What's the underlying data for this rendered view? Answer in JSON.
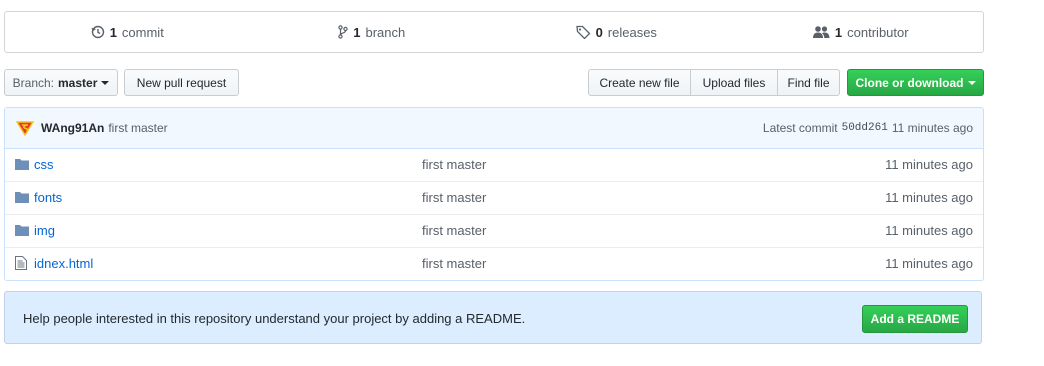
{
  "stats": {
    "commits": {
      "count": "1",
      "label": "commit",
      "icon": "history-icon"
    },
    "branches": {
      "count": "1",
      "label": "branch",
      "icon": "git-branch-icon"
    },
    "releases": {
      "count": "0",
      "label": "releases",
      "icon": "tag-icon"
    },
    "contributors": {
      "count": "1",
      "label": "contributor",
      "icon": "people-icon"
    }
  },
  "toolbar": {
    "branch_prefix": "Branch:",
    "branch_name": "master",
    "new_pull_request": "New pull request",
    "create_new_file": "Create new file",
    "upload_files": "Upload files",
    "find_file": "Find file",
    "clone_or_download": "Clone or download"
  },
  "latest_commit": {
    "author": "WAng91An",
    "message": "first master",
    "prefix": "Latest commit",
    "sha": "50dd261",
    "age": "11 minutes ago"
  },
  "files": [
    {
      "name": "css",
      "type": "folder",
      "message": "first master",
      "age": "11 minutes ago"
    },
    {
      "name": "fonts",
      "type": "folder",
      "message": "first master",
      "age": "11 minutes ago"
    },
    {
      "name": "img",
      "type": "folder",
      "message": "first master",
      "age": "11 minutes ago"
    },
    {
      "name": "idnex.html",
      "type": "file",
      "message": "first master",
      "age": "11 minutes ago"
    }
  ],
  "readme": {
    "text": "Help people interested in this repository understand your project by adding a README.",
    "button": "Add a README"
  },
  "colors": {
    "link": "#0366d6",
    "green": "#28a745",
    "info_bg": "#dbedff",
    "commit_bg": "#f1f8ff"
  }
}
